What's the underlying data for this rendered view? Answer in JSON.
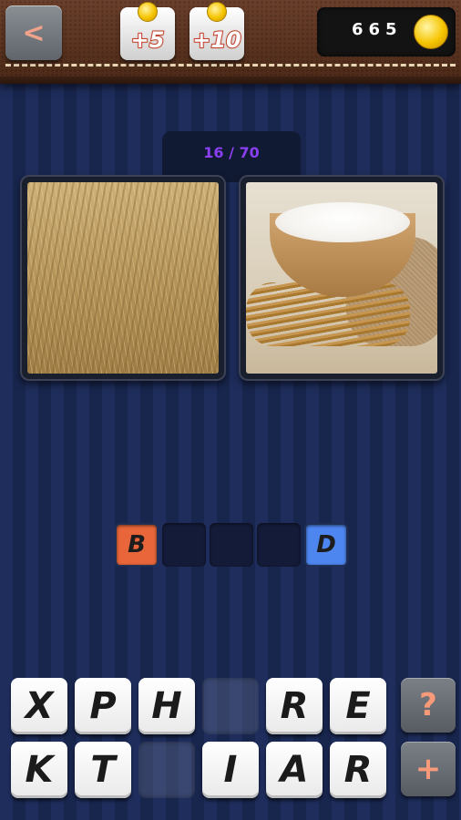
{
  "header": {
    "back_label": "<",
    "bonus_small": "+5",
    "bonus_large": "+10",
    "coins": "665"
  },
  "level": {
    "progress": "16 / 70"
  },
  "images": [
    {
      "icon": "wheat-field-photo"
    },
    {
      "icon": "flour-bowl-photo"
    }
  ],
  "answer": {
    "slots": [
      "B",
      "",
      "",
      "",
      "D"
    ]
  },
  "letters": {
    "row1": [
      "X",
      "P",
      "H",
      "",
      "R",
      "E"
    ],
    "row2": [
      "K",
      "T",
      "",
      "I",
      "A",
      "R"
    ]
  },
  "actions": {
    "hint_label": "?",
    "add_label": "+"
  },
  "colors": {
    "accent_orange": "#e8663a",
    "accent_blue": "#4e86f0",
    "level_text": "#8a3ff0",
    "coin": "#f6c400"
  }
}
